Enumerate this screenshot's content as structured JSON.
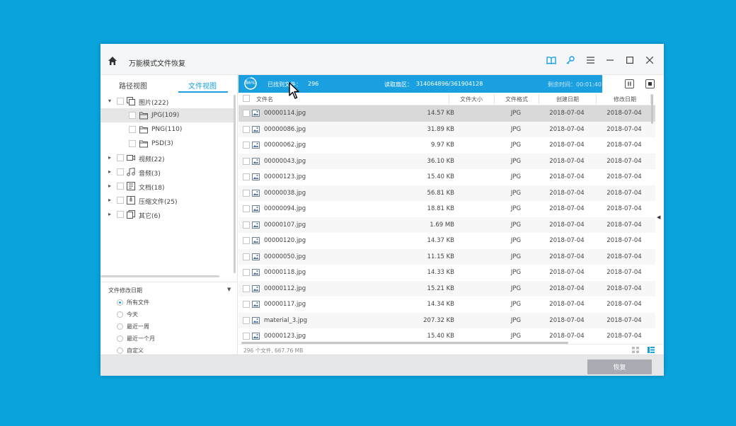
{
  "window": {
    "title": "万能模式文件恢复"
  },
  "sidebar": {
    "tabs": [
      {
        "label": "路径视图",
        "active": false
      },
      {
        "label": "文件视图",
        "active": true
      }
    ],
    "tree": [
      {
        "label": "图片(222)",
        "icon": "image-folder-icon",
        "expanded": true
      },
      {
        "label": "JPG(109)",
        "icon": "folder-icon",
        "selected": true
      },
      {
        "label": "PNG(110)",
        "icon": "folder-icon"
      },
      {
        "label": "PSD(3)",
        "icon": "folder-icon"
      },
      {
        "label": "视频(22)",
        "icon": "video-icon",
        "expanded": false
      },
      {
        "label": "音频(3)",
        "icon": "music-icon",
        "expanded": false
      },
      {
        "label": "文档(18)",
        "icon": "document-icon",
        "expanded": false
      },
      {
        "label": "压缩文件(25)",
        "icon": "archive-icon",
        "expanded": false
      },
      {
        "label": "其它(6)",
        "icon": "other-files-icon",
        "expanded": false
      }
    ],
    "filter": {
      "title": "文件修改日期",
      "options": [
        {
          "label": "所有文件",
          "checked": true
        },
        {
          "label": "今天",
          "checked": false
        },
        {
          "label": "最近一周",
          "checked": false
        },
        {
          "label": "最近一个月",
          "checked": false
        },
        {
          "label": "自定义",
          "checked": false
        }
      ]
    }
  },
  "status": {
    "progress": "86%",
    "progress_fraction": 0.86,
    "found_label": "已找到文件：",
    "found_count": "296",
    "read_label": "读取扇区：",
    "read_value": "314064896/361904128",
    "time_label": "剩余时间：00:01:40"
  },
  "table": {
    "columns": [
      "文件名",
      "文件大小",
      "文件格式",
      "创建日期",
      "修改日期"
    ],
    "rows": [
      {
        "name": "00000114.jpg",
        "size": "14.57 KB",
        "format": "JPG",
        "created": "2018-07-04",
        "modified": "2018-07-04"
      },
      {
        "name": "00000086.jpg",
        "size": "31.89 KB",
        "format": "JPG",
        "created": "2018-07-04",
        "modified": "2018-07-04"
      },
      {
        "name": "00000062.jpg",
        "size": "9.97 KB",
        "format": "JPG",
        "created": "2018-07-04",
        "modified": "2018-07-04"
      },
      {
        "name": "00000043.jpg",
        "size": "36.10 KB",
        "format": "JPG",
        "created": "2018-07-04",
        "modified": "2018-07-04"
      },
      {
        "name": "00000123.jpg",
        "size": "15.40 KB",
        "format": "JPG",
        "created": "2018-07-04",
        "modified": "2018-07-04"
      },
      {
        "name": "00000038.jpg",
        "size": "56.81 KB",
        "format": "JPG",
        "created": "2018-07-04",
        "modified": "2018-07-04"
      },
      {
        "name": "00000094.jpg",
        "size": "18.81 KB",
        "format": "JPG",
        "created": "2018-07-04",
        "modified": "2018-07-04"
      },
      {
        "name": "00000107.jpg",
        "size": "1.69 MB",
        "format": "JPG",
        "created": "2018-07-04",
        "modified": "2018-07-04"
      },
      {
        "name": "00000120.jpg",
        "size": "14.37 KB",
        "format": "JPG",
        "created": "2018-07-04",
        "modified": "2018-07-04"
      },
      {
        "name": "00000050.jpg",
        "size": "11.15 KB",
        "format": "JPG",
        "created": "2018-07-04",
        "modified": "2018-07-04"
      },
      {
        "name": "00000118.jpg",
        "size": "14.33 KB",
        "format": "JPG",
        "created": "2018-07-04",
        "modified": "2018-07-04"
      },
      {
        "name": "00000112.jpg",
        "size": "15.21 KB",
        "format": "JPG",
        "created": "2018-07-04",
        "modified": "2018-07-04"
      },
      {
        "name": "00000117.jpg",
        "size": "14.34 KB",
        "format": "JPG",
        "created": "2018-07-04",
        "modified": "2018-07-04"
      },
      {
        "name": "material_3.jpg",
        "size": "207.32 KB",
        "format": "JPG",
        "created": "2018-07-04",
        "modified": "2018-07-04"
      },
      {
        "name": "00000123.jpg",
        "size": "15.40 KB",
        "format": "JPG",
        "created": "2018-07-04",
        "modified": "2018-07-04"
      }
    ]
  },
  "footer": {
    "summary": "296 个文件, 667.76 MB"
  },
  "actions": {
    "recover_label": "恢复"
  },
  "colors": {
    "accent": "#1aa0e0",
    "background": "#0aa3dc",
    "recover_button": "#a9adb3"
  }
}
